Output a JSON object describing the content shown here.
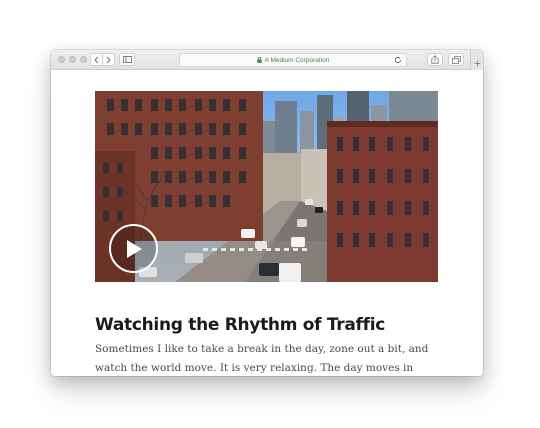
{
  "browser": {
    "address": "A Medium Corporation",
    "colors": {
      "address_text": "#3a8a4a",
      "titlebar": "#e9e8e9"
    }
  },
  "article": {
    "video": {
      "play_icon": "play-icon"
    },
    "title": "Watching the Rhythm of Traffic",
    "body": "Sometimes I like to take a break in the day, zone out a bit, and watch the world move. It is very relaxing. The day moves in cycles, breathing in and"
  }
}
